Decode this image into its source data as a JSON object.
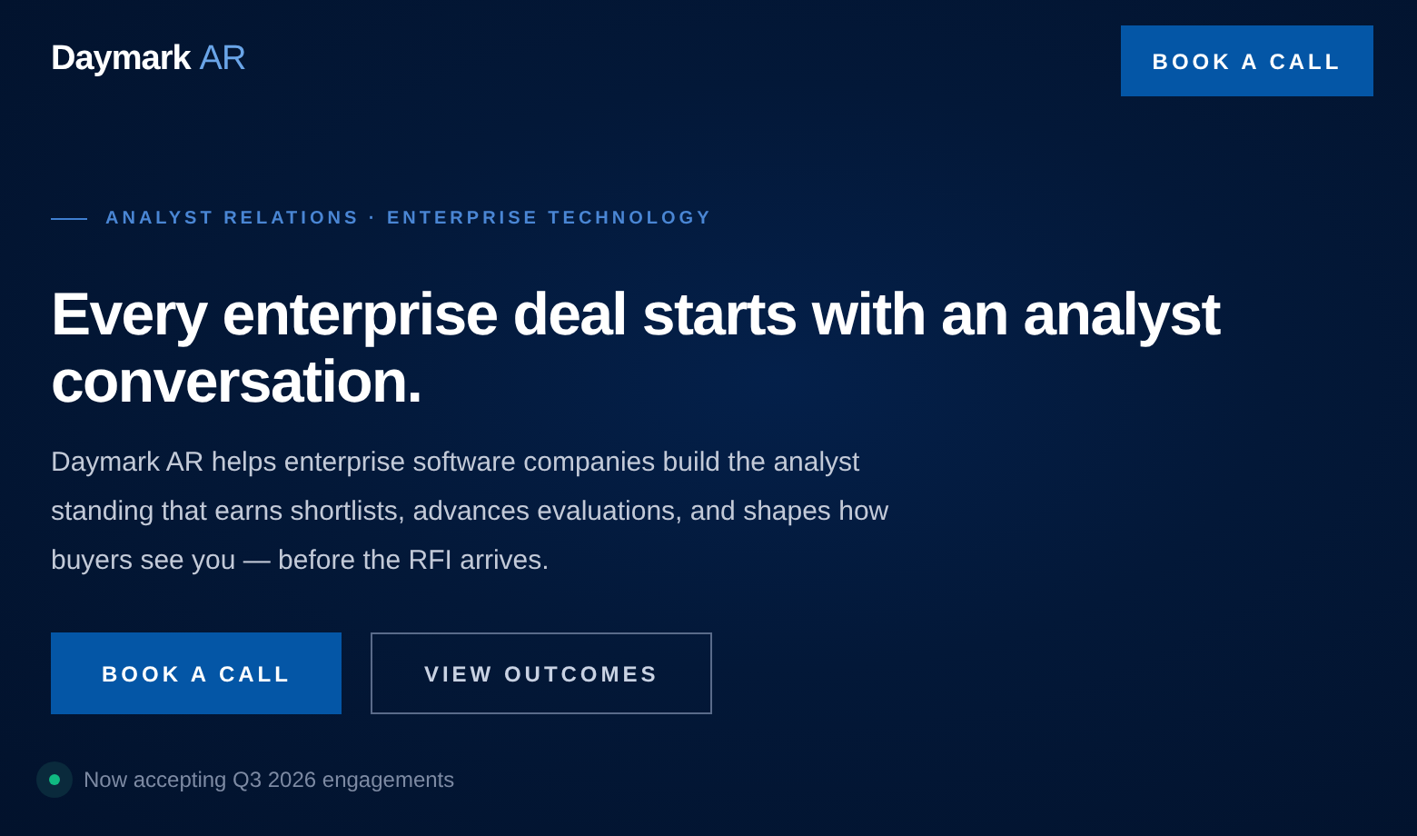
{
  "brand": {
    "name": "Daymark",
    "suffix": "AR"
  },
  "nav_button": "BOOK A CALL",
  "eyebrow": "ANALYST RELATIONS · ENTERPRISE TECHNOLOGY",
  "headline": "Every enterprise deal starts with an analyst conversation.",
  "body": "Daymark AR helps enterprise software companies build the analyst standing that earns shortlists, advances evaluations, and shapes how buyers see you — before the RFI arrives.",
  "actions": [
    {
      "label": "BOOK A CALL",
      "kind": "primary"
    },
    {
      "label": "VIEW OUTCOMES",
      "kind": "secondary"
    }
  ],
  "status": {
    "text": "Now accepting Q3 2026 engagements",
    "color": "#10b981"
  }
}
